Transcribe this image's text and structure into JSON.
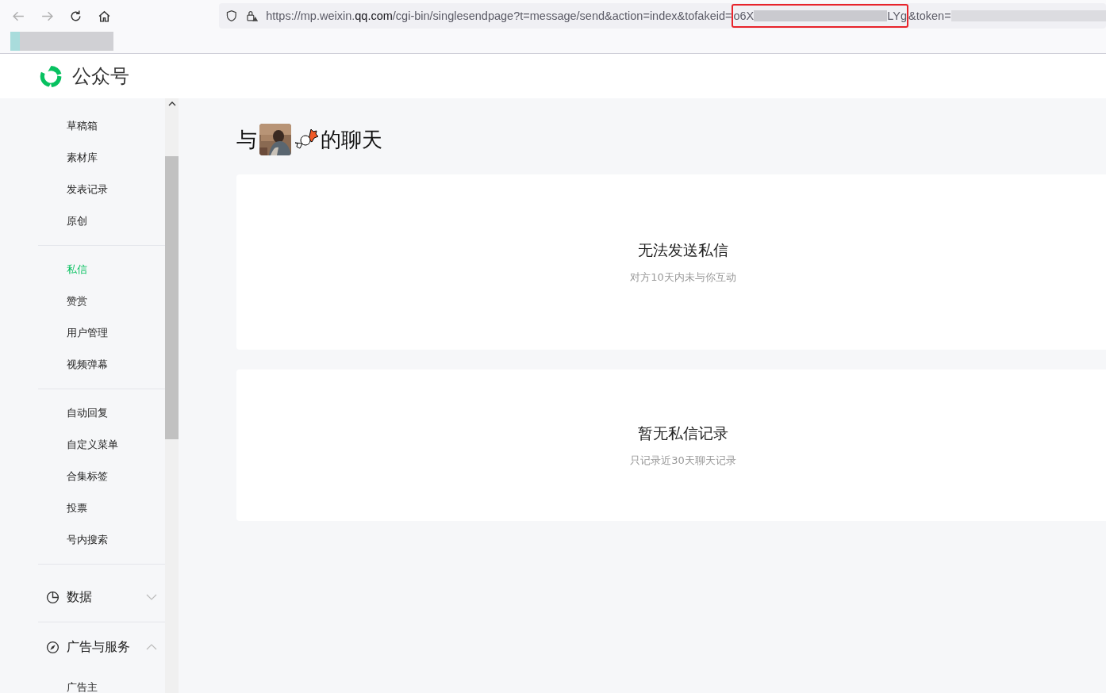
{
  "browser": {
    "url_start": "https://mp.weixin.",
    "url_host_bold": "qq.com",
    "url_path": "/cgi-bin/singlesendpage?t=message/send&action=index&tofakeid=",
    "url_highlight_start": "o6X",
    "url_highlight_end": "LYg",
    "url_end": "&token="
  },
  "header": {
    "title": "公众号"
  },
  "sidebar": {
    "groups": [
      {
        "items": [
          {
            "label": "草稿箱",
            "selected": false
          },
          {
            "label": "素材库",
            "selected": false
          },
          {
            "label": "发表记录",
            "selected": false
          },
          {
            "label": "原创",
            "selected": false
          }
        ]
      },
      {
        "items": [
          {
            "label": "私信",
            "selected": true
          },
          {
            "label": "赞赏",
            "selected": false
          },
          {
            "label": "用户管理",
            "selected": false
          },
          {
            "label": "视频弹幕",
            "selected": false
          }
        ]
      },
      {
        "items": [
          {
            "label": "自动回复",
            "selected": false
          },
          {
            "label": "自定义菜单",
            "selected": false
          },
          {
            "label": "合集标签",
            "selected": false
          },
          {
            "label": "投票",
            "selected": false
          },
          {
            "label": "号内搜索",
            "selected": false
          }
        ]
      }
    ],
    "sections": [
      {
        "kind": "chart",
        "label": "数据",
        "expanded": false
      },
      {
        "kind": "compass",
        "label": "广告与服务",
        "expanded": true,
        "children": [
          {
            "label": "广告主",
            "selected": false
          }
        ]
      }
    ]
  },
  "chat": {
    "title_prefix": "与",
    "title_suffix": "的聊天"
  },
  "cards": [
    {
      "title": "无法发送私信",
      "subtitle": "对方10天内未与你互动"
    },
    {
      "title": "暂无私信记录",
      "subtitle": "只记录近30天聊天记录"
    }
  ]
}
